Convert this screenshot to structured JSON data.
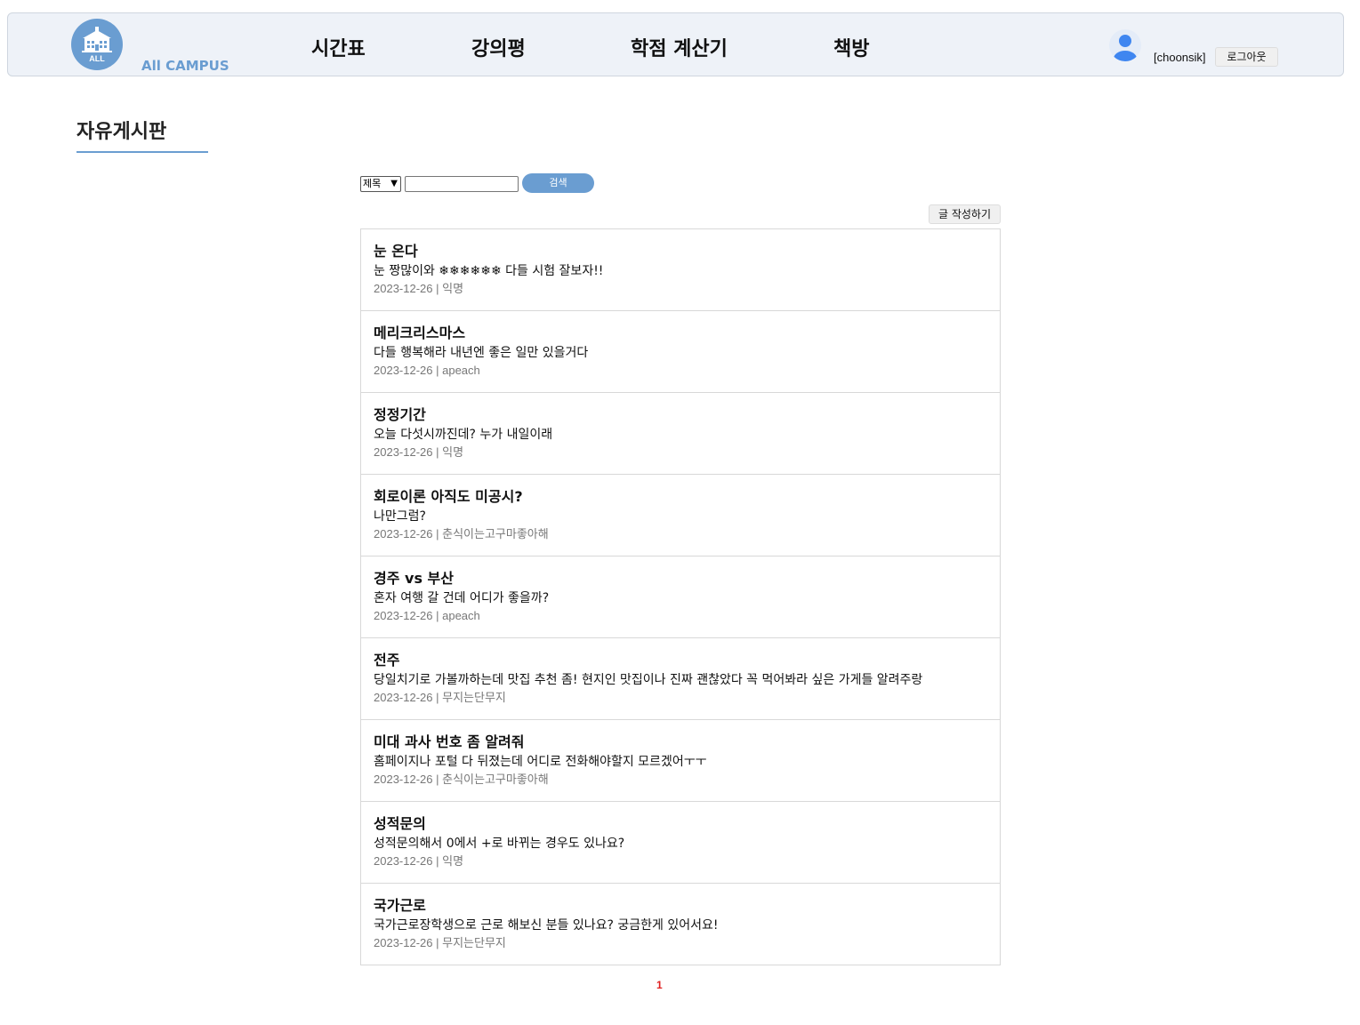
{
  "header": {
    "logo_badge": "ALL",
    "logo_text": "All CAMPUS",
    "nav": [
      "시간표",
      "강의평",
      "학점 계산기",
      "책방"
    ],
    "user_name": "[choonsik]",
    "logout_label": "로그아웃",
    "brand_color": "#6a9dd1"
  },
  "board": {
    "title": "자유게시판"
  },
  "search": {
    "select_value": "제목",
    "input_value": "",
    "button_label": "검색"
  },
  "write_button_label": "글 작성하기",
  "posts": [
    {
      "title": "눈 온다",
      "body": "눈 짱많이와 ❄❄❄❄❄❄ 다들 시험 잘보자!!",
      "date": "2023-12-26",
      "author": "익명"
    },
    {
      "title": "메리크리스마스",
      "body": "다들 행복해라 내년엔 좋은 일만 있을거다",
      "date": "2023-12-26",
      "author": "apeach"
    },
    {
      "title": "정정기간",
      "body": "오늘 다섯시까진데? 누가 내일이래",
      "date": "2023-12-26",
      "author": "익명"
    },
    {
      "title": "회로이론 아직도 미공시?",
      "body": "나만그럼?",
      "date": "2023-12-26",
      "author": "춘식이는고구마좋아해"
    },
    {
      "title": "경주 vs 부산",
      "body": "혼자 여행 갈 건데 어디가 좋을까?",
      "date": "2023-12-26",
      "author": "apeach"
    },
    {
      "title": "전주",
      "body": "당일치기로 가볼까하는데 맛집 추천 좀! 현지인 맛집이나 진짜 괜찮았다 꼭 먹어봐라 싶은 가게들 알려주랑",
      "date": "2023-12-26",
      "author": "무지는단무지"
    },
    {
      "title": "미대 과사 번호 좀 알려줘",
      "body": "홈페이지나 포털 다 뒤졌는데 어디로 전화해야할지 모르겠어ㅜㅜ",
      "date": "2023-12-26",
      "author": "춘식이는고구마좋아해"
    },
    {
      "title": "성적문의",
      "body": "성적문의해서 0에서 +로 바뀌는 경우도 있나요?",
      "date": "2023-12-26",
      "author": "익명"
    },
    {
      "title": "국가근로",
      "body": "국가근로장학생으로 근로 해보신 분들 있나요? 궁금한게 있어서요!",
      "date": "2023-12-26",
      "author": "무지는단무지"
    }
  ],
  "meta_separator": " | ",
  "pagination": {
    "current": "1"
  }
}
